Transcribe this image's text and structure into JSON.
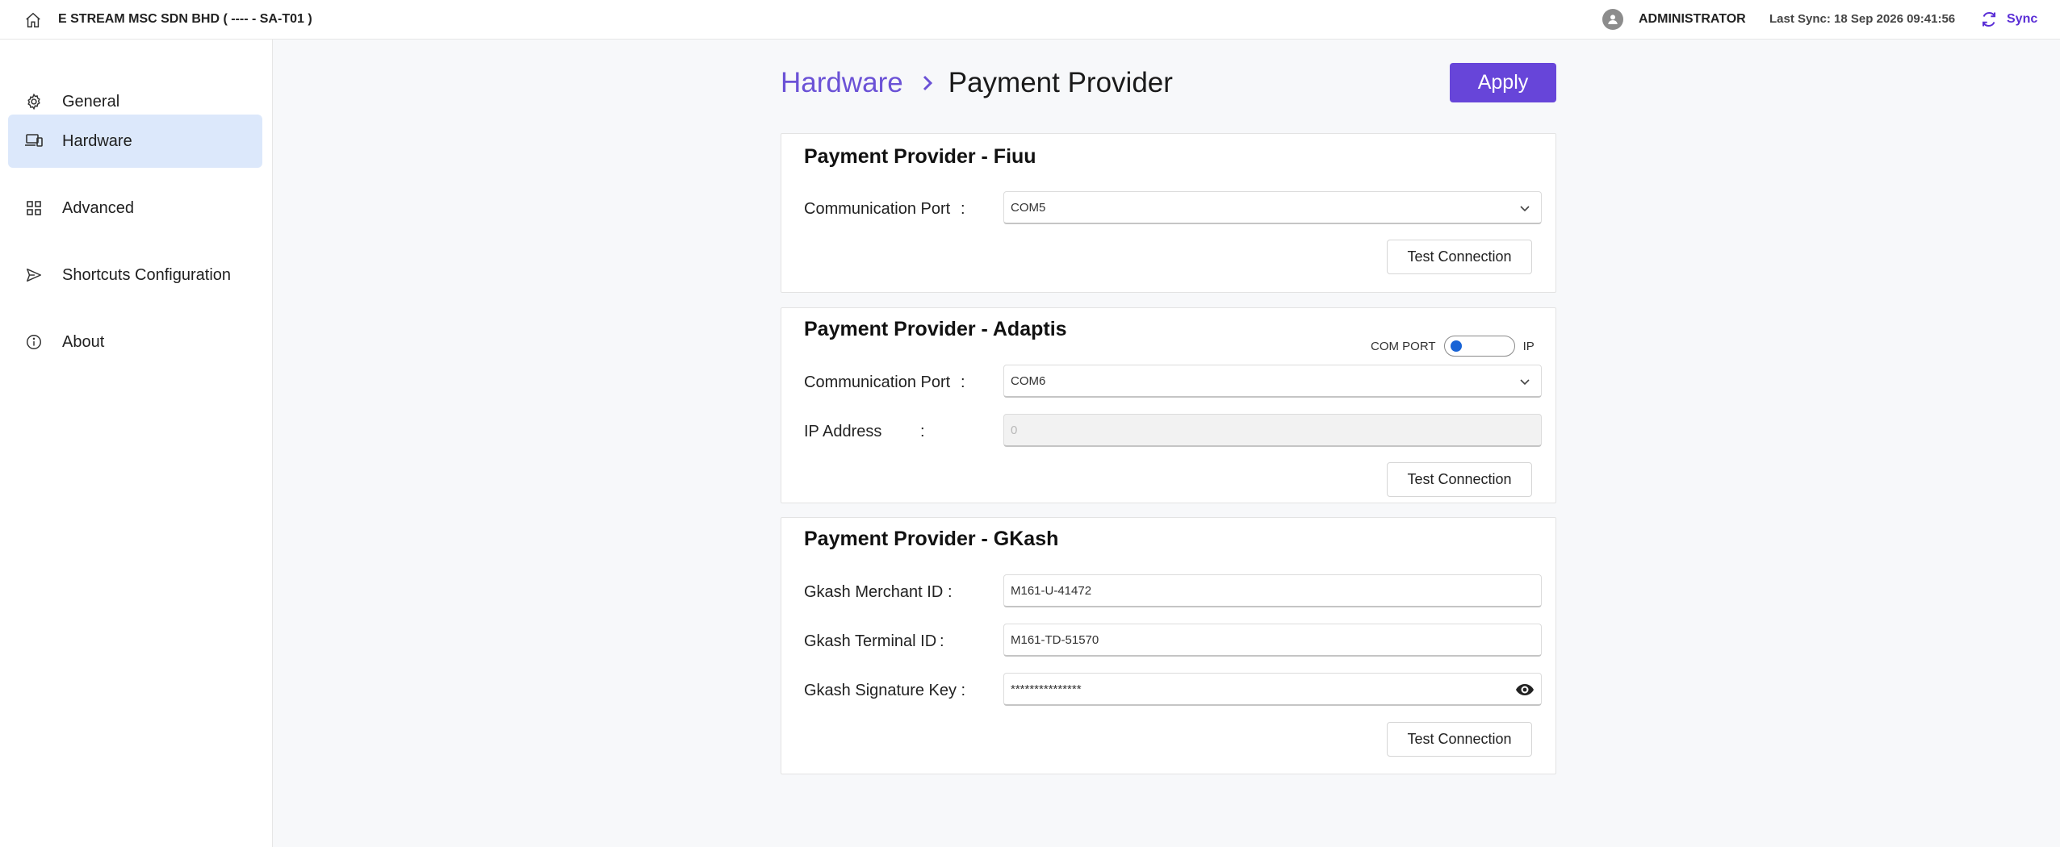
{
  "header": {
    "company": "E STREAM MSC SDN BHD ( ---- - SA-T01 )",
    "user": "ADMINISTRATOR",
    "last_sync": "Last Sync: 18 Sep 2026 09:41:56",
    "sync_label": "Sync"
  },
  "sidebar": {
    "items": [
      {
        "label": "General",
        "icon": "gear-icon"
      },
      {
        "label": "Hardware",
        "icon": "laptop-phone-icon",
        "active": true
      },
      {
        "label": "Advanced",
        "icon": "grid-icon"
      },
      {
        "label": "Shortcuts Configuration",
        "icon": "send-icon"
      },
      {
        "label": "About",
        "icon": "info-icon"
      }
    ]
  },
  "breadcrumb": {
    "parent": "Hardware",
    "current": "Payment Provider"
  },
  "apply_label": "Apply",
  "colors": {
    "accent": "#6745d9",
    "sync": "#5b2fd6",
    "active_nav": "#dce8fb",
    "toggle_knob": "#1863d6"
  },
  "fiuu": {
    "title": "Payment Provider - Fiuu",
    "port_label": "Communication Port",
    "colon": ":",
    "port_value": "COM5",
    "test_label": "Test Connection"
  },
  "adaptis": {
    "title": "Payment Provider - Adaptis",
    "toggle_left": "COM PORT",
    "toggle_right": "IP",
    "port_label": "Communication Port",
    "colon": ":",
    "port_value": "COM6",
    "ip_label": "IP Address",
    "ip_value": "0",
    "test_label": "Test Connection"
  },
  "gkash": {
    "title": "Payment Provider - GKash",
    "merchant_label": "Gkash Merchant ID",
    "merchant_value": "M161-U-41472",
    "terminal_label": "Gkash Terminal ID",
    "terminal_value": "M161-TD-51570",
    "signature_label": "Gkash Signature Key :",
    "signature_value": "***************",
    "colon": ":",
    "test_label": "Test Connection"
  }
}
